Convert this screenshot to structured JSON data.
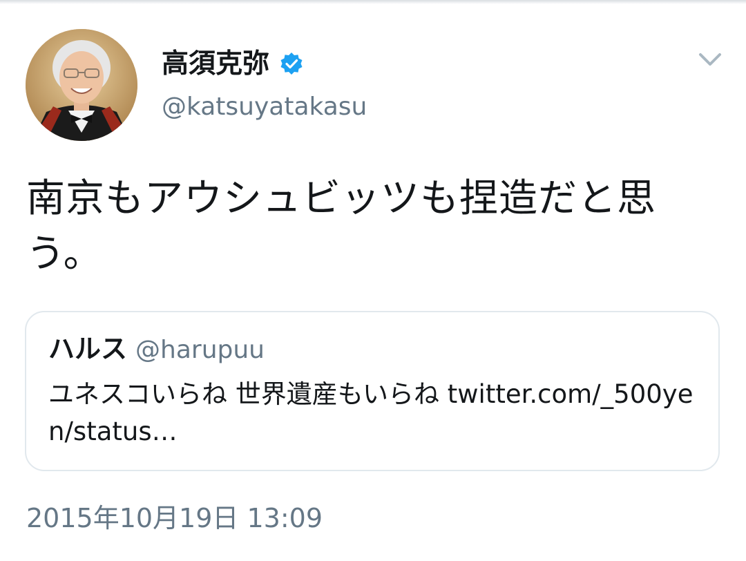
{
  "author": {
    "display_name": "高須克弥",
    "handle": "@katsuyatakasu",
    "verified": true
  },
  "tweet": {
    "text": "南京もアウシュビッツも捏造だと思う。"
  },
  "quoted_tweet": {
    "display_name": "ハルス",
    "handle": "@harupuu",
    "text": "ユネスコいらね 世界遺産もいらね twitter.com/_500yen/status…"
  },
  "timestamp": "2015年10月19日 13:09",
  "icons": {
    "verified": "verified-badge-icon",
    "menu": "chevron-down-icon"
  },
  "colors": {
    "text_primary": "#14171a",
    "text_secondary": "#657786",
    "verified_blue": "#1da1f2",
    "card_border": "#e1e8ed",
    "chevron": "#aab8c2"
  }
}
